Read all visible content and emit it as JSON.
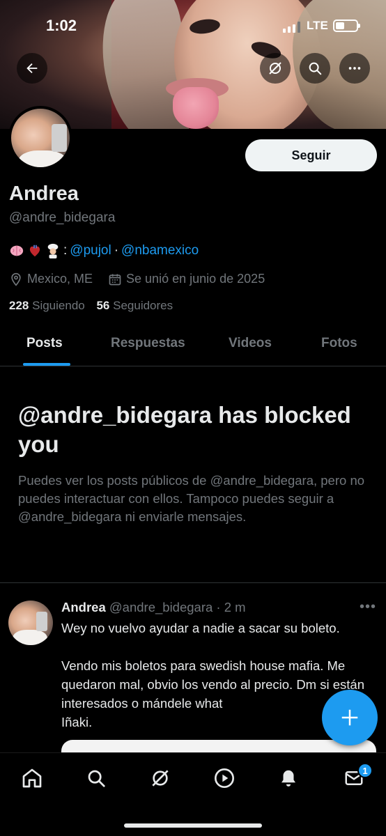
{
  "status_bar": {
    "time": "1:02",
    "network": "LTE"
  },
  "profile": {
    "name": "Andrea",
    "handle": "@andre_bidegara",
    "follow_label": "Seguir",
    "bio_separator": ":",
    "bio_link_1": "@pujol",
    "bio_dot": "·",
    "bio_link_2": "@nbamexico",
    "bio_emojis": [
      "brain",
      "anatomical-heart",
      "chef"
    ],
    "location": "Mexico, ME",
    "joined": "Se unió en junio de 2025",
    "following_count": "228",
    "following_label": "Siguiendo",
    "followers_count": "56",
    "followers_label": "Seguidores"
  },
  "tabs": [
    {
      "label": "Posts",
      "active": true
    },
    {
      "label": "Respuestas",
      "active": false
    },
    {
      "label": "Videos",
      "active": false
    },
    {
      "label": "Fotos",
      "active": false
    }
  ],
  "blocked": {
    "title": "@andre_bidegara has blocked you",
    "body": "Puedes ver los posts públicos de @andre_bidegara, pero no puedes interactuar con ellos. Tampoco puedes seguir a @andre_bidegara ni enviarle mensajes."
  },
  "post": {
    "author": "Andrea",
    "handle": "@andre_bidegara",
    "time": "· 2 m",
    "more": "•••",
    "text": "Wey no vuelvo ayudar a nadie a sacar su boleto.\n\nVendo mis boletos para swedish house mafia. Me quedaron mal, obvio los vendo al precio. Dm si están interesados o mándele what\nIñaki."
  },
  "fab": {
    "icon": "plus-icon"
  },
  "bottom_nav": {
    "items": [
      "home-icon",
      "search-icon",
      "grok-icon",
      "play-icon",
      "bell-icon",
      "mail-icon"
    ],
    "messages_badge": "1"
  },
  "colors": {
    "accent": "#1d9bf0",
    "background": "#000000",
    "muted": "#71767b"
  }
}
